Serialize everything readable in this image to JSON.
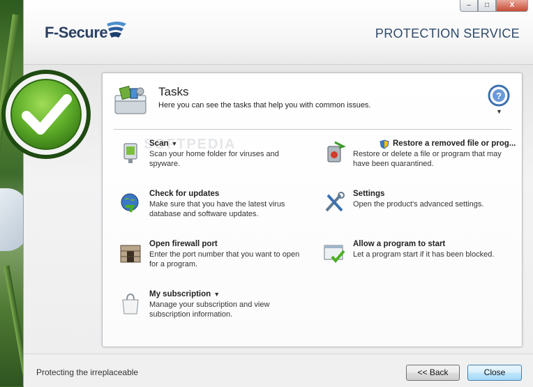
{
  "window": {
    "brand": "F-Secure",
    "service_title": "PROTECTION SERVICE",
    "controls": {
      "minimize": "–",
      "maximize": "□",
      "close": "X"
    }
  },
  "panel": {
    "title": "Tasks",
    "subtitle": "Here you can see the tasks that help you with common issues."
  },
  "watermark": "SOFTPEDIA",
  "tasks": [
    {
      "name": "Scan",
      "dropdown": true,
      "desc": "Scan your home folder for viruses and spyware.",
      "icon": "scan-icon"
    },
    {
      "name": "Restore a removed file or prog...",
      "dropdown": false,
      "desc": "Restore or delete a file or program that may have been quarantined.",
      "icon": "restore-icon"
    },
    {
      "name": "Check for updates",
      "dropdown": false,
      "desc": "Make sure that you have the latest virus database and software updates.",
      "icon": "update-icon"
    },
    {
      "name": "Settings",
      "dropdown": false,
      "desc": "Open the product's advanced settings.",
      "icon": "settings-icon"
    },
    {
      "name": "Open firewall port",
      "dropdown": false,
      "desc": "Enter the port number that you want to open for a program.",
      "icon": "firewall-icon"
    },
    {
      "name": "Allow a program to start",
      "dropdown": false,
      "desc": "Let a program start if it has been blocked.",
      "icon": "allow-program-icon"
    },
    {
      "name": "My subscription",
      "dropdown": true,
      "desc": "Manage your subscription and view subscription information.",
      "icon": "subscription-icon"
    }
  ],
  "footer": {
    "text": "Protecting the irreplaceable",
    "back_label": "<< Back",
    "close_label": "Close"
  },
  "colors": {
    "brand_blue": "#2a3f63",
    "status_green": "#4caf22"
  }
}
